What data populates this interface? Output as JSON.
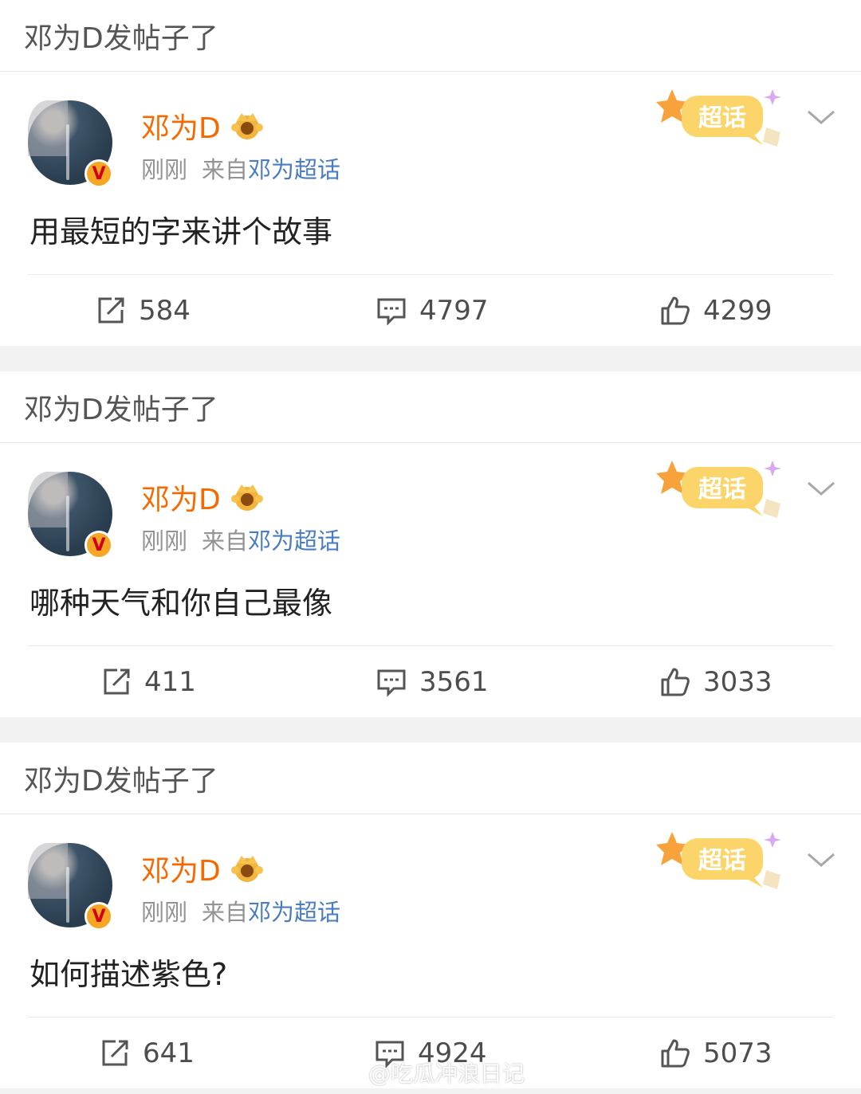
{
  "posts": [
    {
      "header": "邓为D发帖子了",
      "username": "邓为D",
      "time": "刚刚",
      "source_prefix": "来自",
      "source_link": "邓为超话",
      "badge_text": "超话",
      "content": "用最短的字来讲个故事",
      "repost_count": "584",
      "comment_count": "4797",
      "like_count": "4299"
    },
    {
      "header": "邓为D发帖子了",
      "username": "邓为D",
      "time": "刚刚",
      "source_prefix": "来自",
      "source_link": "邓为超话",
      "badge_text": "超话",
      "content": "哪种天气和你自己最像",
      "repost_count": "411",
      "comment_count": "3561",
      "like_count": "3033"
    },
    {
      "header": "邓为D发帖子了",
      "username": "邓为D",
      "time": "刚刚",
      "source_prefix": "来自",
      "source_link": "邓为超话",
      "badge_text": "超话",
      "content": "如何描述紫色?",
      "repost_count": "641",
      "comment_count": "4924",
      "like_count": "5073"
    }
  ],
  "verified_badge": "V",
  "watermark": "@吃瓜冲浪日记",
  "colors": {
    "username": "#f56a00",
    "link": "#4a7cc2",
    "meta": "#939393",
    "badge_bg": "#f5a623"
  }
}
